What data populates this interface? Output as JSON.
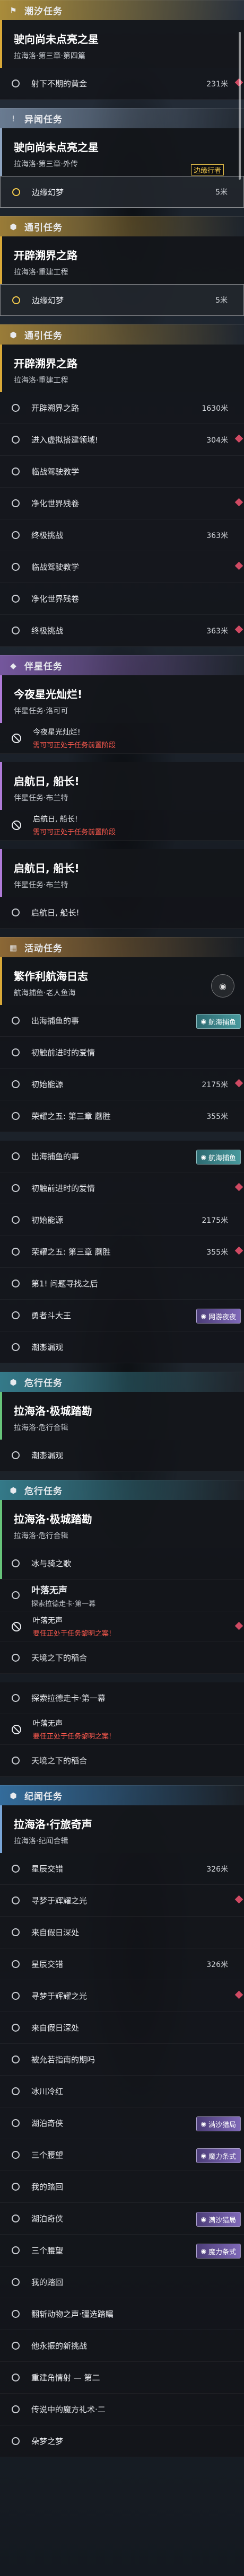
{
  "colors": {
    "accent_gold": "#d9a938",
    "marker_red": "#d04a63",
    "warning_red": "#ff5a4e",
    "teal_tag": "#48999d",
    "purple_tag": "#7f69b8"
  },
  "icons": [
    "flag-icon",
    "exclamation-icon",
    "hexagon-gem-icon",
    "diamond-pin-icon",
    "prohibited-icon",
    "circle-marker-icon",
    "vr-headset-icon",
    "calendar-icon"
  ],
  "quest_list": [
    {
      "header": {
        "label": "潮汐任务",
        "icon": "flag-icon",
        "color": "#c9a23a"
      },
      "card": {
        "title": "驶向尚未点亮之星",
        "subtitle": "拉海洛·第三章·第四篇",
        "accent": "#d9a938"
      },
      "rows": [
        {
          "label": "射下不期的黄金",
          "distance": "231米",
          "pin": true
        }
      ]
    },
    {
      "header": {
        "label": "异闻任务",
        "icon": "exclamation-icon",
        "color": "#7b8fa8"
      },
      "card": {
        "title": "驶向尚未点亮之星",
        "subtitle": "拉海洛·第三章·外传",
        "accent": "#8ea4c0",
        "tag": "边缘行者"
      },
      "rows": [
        {
          "label": "边缘幻梦",
          "distance": "5米",
          "selected": true
        }
      ]
    },
    {
      "header": {
        "label": "通引任务",
        "icon": "hexagon-gem-icon",
        "color": "#b8913a"
      },
      "card": {
        "title": "开辟溯界之路",
        "subtitle": "拉海洛·重建工程",
        "accent": "#d9a938"
      },
      "rows": [
        {
          "label": "边缘幻梦",
          "distance": "5米",
          "selected": true
        }
      ]
    },
    {
      "header": {
        "label": "通引任务",
        "icon": "hexagon-gem-icon",
        "color": "#b8913a"
      },
      "card": {
        "title": "开辟溯界之路",
        "subtitle": "拉海洛·重建工程",
        "accent": "#d9a938"
      },
      "rows": [
        {
          "label": "开辟溯界之路",
          "distance": "1630米"
        },
        {
          "label": "进入虚拟搭建领域!",
          "distance": "304米",
          "pin": true
        },
        {
          "label": "临战驾驶教学"
        },
        {
          "label": "净化世界残卷",
          "pin": true
        },
        {
          "label": "终极挑战",
          "distance": "363米"
        },
        {
          "label": "临战驾驶教学",
          "pin": true
        },
        {
          "label": "净化世界残卷"
        },
        {
          "label": "终极挑战",
          "distance": "363米",
          "pin": true
        }
      ]
    },
    {
      "header": {
        "label": "伴星任务",
        "icon": "diamond-pin-icon",
        "color": "#8a63b8"
      },
      "card": {
        "title": "今夜星光灿烂!",
        "subtitle": "伴星任务·洛可可",
        "accent": "#b07bd8"
      },
      "rows": [
        {
          "label": "今夜星光灿烂!",
          "warning": "需可可正处于任务前置阶段",
          "notice": true
        }
      ]
    },
    {
      "header": null,
      "card": {
        "title": "启航日, 船长!",
        "subtitle": "伴星任务·布兰特",
        "accent": "#b07bd8"
      },
      "rows": [
        {
          "label": "启航日, 船长!",
          "warning": "需可可正处于任务前置阶段",
          "notice": true
        }
      ]
    },
    {
      "header": null,
      "card": {
        "title": "启航日, 船长!",
        "subtitle": "伴星任务·布兰特",
        "accent": "#b07bd8"
      },
      "rows": [
        {
          "label": "启航日, 船长!"
        }
      ]
    },
    {
      "header": {
        "label": "活动任务",
        "icon": "calendar-icon",
        "color": "#a87a3a"
      },
      "card": {
        "title": "繁作利航海日志",
        "subtitle": "航海捕鱼·老人鱼海",
        "accent": "#d9a938",
        "badge": "vr-headset-icon"
      },
      "rows": [
        {
          "label": "出海捕鱼的事",
          "tag": "航海捕鱼",
          "tag_color": "teal"
        },
        {
          "label": "初触前进时的爱情"
        },
        {
          "label": "初始能源",
          "distance": "2175米",
          "pin": true
        },
        {
          "label": "荣耀之五: 第三章 蘑胜",
          "distance": "355米"
        }
      ]
    },
    {
      "header": null,
      "card": null,
      "rows": [
        {
          "label": "出海捕鱼的事",
          "tag": "航海捕鱼",
          "tag_color": "teal"
        },
        {
          "label": "初触前进时的爱情",
          "pin": true
        },
        {
          "label": "初始能源",
          "distance": "2175米"
        },
        {
          "label": "荣耀之五: 第三章 蘑胜",
          "distance": "355米",
          "pin": true
        },
        {
          "label": "第1! 问题寻找之后"
        },
        {
          "label": "勇者斗大王",
          "tag": "网游夜夜",
          "tag_color": "purple"
        },
        {
          "label": "潮澎漏观"
        }
      ]
    },
    {
      "header": {
        "label": "危行任务",
        "icon": "hexagon-gem-icon",
        "color": "#3a8fa0"
      },
      "card": {
        "title": "拉海洛·极城踏勘",
        "subtitle": "拉海洛·危行合辑",
        "accent": "#67c47a"
      },
      "rows": [
        {
          "label": "潮澎漏观"
        }
      ]
    },
    {
      "header": {
        "label": "危行任务",
        "icon": "hexagon-gem-icon",
        "color": "#3a8fa0"
      },
      "card": {
        "title": "拉海洛·极城踏勘",
        "subtitle": "拉海洛·危行合辑",
        "accent": "#67c47a"
      },
      "rows": [
        {
          "label": "冰与骑之歌",
          "green": true
        },
        {
          "label": "叶落无声",
          "title_row": true,
          "sub": "探索拉德走卡·第一幕"
        },
        {
          "label": "叶落无声",
          "warning": "要任正处于任务黎明之案!",
          "notice": true,
          "pin": true
        },
        {
          "label": "天境之下的稻合"
        }
      ]
    },
    {
      "header": null,
      "card": null,
      "rows": [
        {
          "label": "探索拉德走卡·第一幕"
        },
        {
          "label": "叶落无声",
          "warning": "要任正处于任务黎明之案!",
          "notice": true
        },
        {
          "label": "天境之下的稻合"
        }
      ]
    },
    {
      "header": {
        "label": "纪闻任务",
        "icon": "hexagon-gem-icon",
        "color": "#3a7fb8"
      },
      "card": {
        "title": "拉海洛·行旅奇声",
        "subtitle": "拉海洛·纪闻合辑",
        "accent": "#7aa6d8"
      },
      "rows": [
        {
          "label": "星辰交错",
          "distance": "326米"
        },
        {
          "label": "寻梦于辉耀之光",
          "pin": true
        },
        {
          "label": "来自假日深处"
        },
        {
          "label": "星辰交错",
          "distance": "326米"
        },
        {
          "label": "寻梦于辉耀之光",
          "pin": true
        },
        {
          "label": "来自假日深处"
        },
        {
          "label": "被允若指南的期吗"
        },
        {
          "label": "冰川冷红"
        },
        {
          "label": "湖泊奇侠",
          "tag": "满沙猎局",
          "tag_color": "purple"
        },
        {
          "label": "三个腰望",
          "tag": "魔力条式",
          "tag_color": "purple"
        },
        {
          "label": "我的踏回"
        },
        {
          "label": "湖泊奇侠",
          "tag": "满沙猎局",
          "tag_color": "purple"
        },
        {
          "label": "三个腰望",
          "tag": "魔力条式",
          "tag_color": "purple"
        },
        {
          "label": "我的踏回"
        },
        {
          "label": "翻斩动物之声·疆选踏瞩"
        },
        {
          "label": "他永振的新挑战"
        },
        {
          "label": "重建角情射 — 第二"
        },
        {
          "label": "传说中的魔方礼术·二"
        },
        {
          "label": "朵梦之梦"
        }
      ]
    }
  ]
}
